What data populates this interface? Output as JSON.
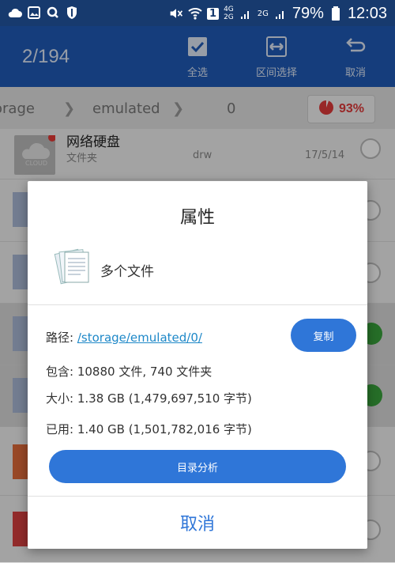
{
  "status_bar": {
    "battery": "79%",
    "time": "12:03",
    "sim": "1",
    "net_a": "4G",
    "net_b": "2G",
    "net_c": "2G"
  },
  "app_bar": {
    "counter": "2/194",
    "actions": [
      {
        "label": "全选",
        "icon": "check-box-icon"
      },
      {
        "label": "区间选择",
        "icon": "range-select-icon"
      },
      {
        "label": "取消",
        "icon": "undo-icon"
      }
    ]
  },
  "path_bar": {
    "segments": [
      "orage",
      "emulated",
      "0"
    ],
    "storage_percent": "93%"
  },
  "list": {
    "first_row": {
      "name": "网络硬盘",
      "type": "文件夹",
      "perm": "drw",
      "date": "17/5/14",
      "thumb_label": "CLOUD"
    }
  },
  "dialog": {
    "title": "属性",
    "file_name": "多个文件",
    "path_label": "路径:",
    "path_value": "/storage/emulated/0/",
    "copy_label": "复制",
    "contains_label": "包含:",
    "contains_value": "10880 文件, 740 文件夹",
    "size_label": "大小:",
    "size_value": "1.38 GB (1,479,697,510 字节)",
    "used_label": "已用:",
    "used_value": "1.40 GB (1,501,782,016 字节)",
    "analyze_label": "目录分析",
    "cancel_label": "取消"
  },
  "colors": {
    "appbar": "#1f5bb7",
    "statusbar": "#173a6e",
    "accent": "#2f76d8",
    "check": "#39a23c",
    "storage_warn": "#e03a3a"
  }
}
